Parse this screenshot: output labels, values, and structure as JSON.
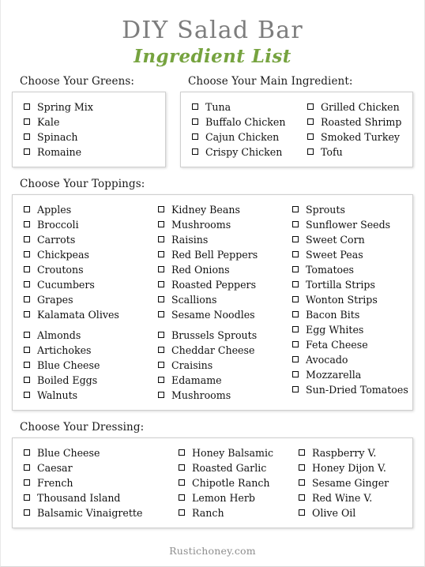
{
  "title": {
    "main": "DIY Salad Bar",
    "sub": "Ingredient List",
    "main_color": "#7d7d7d",
    "sub_color": "#76a33f"
  },
  "sections": {
    "greens": {
      "label": "Choose Your Greens:",
      "items": [
        "Spring Mix",
        "Kale",
        "Spinach",
        "Romaine"
      ]
    },
    "main_ingredient": {
      "label": "Choose Your Main Ingredient:",
      "col1": [
        "Tuna",
        "Buffalo Chicken",
        "Cajun Chicken",
        "Crispy Chicken"
      ],
      "col2": [
        "Grilled Chicken",
        "Roasted Shrimp",
        "Smoked Turkey",
        "Tofu"
      ]
    },
    "toppings": {
      "label": "Choose Your Toppings:",
      "col1": [
        "Apples",
        "Broccoli",
        "Carrots",
        "Chickpeas",
        "Croutons",
        "Cucumbers",
        "Grapes",
        "Kalamata Olives",
        "Almonds",
        "Artichokes",
        "Blue Cheese",
        "Boiled Eggs",
        "Walnuts"
      ],
      "col2": [
        "Kidney Beans",
        "Mushrooms",
        "Raisins",
        "Red Bell Peppers",
        "Red Onions",
        "Roasted Peppers",
        "Scallions",
        "Sesame Noodles",
        "Brussels Sprouts",
        "Cheddar Cheese",
        "Craisins",
        "Edamame",
        "Mushrooms"
      ],
      "col3": [
        "Sprouts",
        "Sunflower Seeds",
        "Sweet Corn",
        "Sweet Peas",
        "Tomatoes",
        "Tortilla Strips",
        "Wonton Strips",
        "Bacon Bits",
        "Egg Whites",
        "Feta Cheese",
        "Avocado",
        "Mozzarella",
        "Sun-Dried Tomatoes"
      ]
    },
    "dressing": {
      "label": "Choose Your Dressing:",
      "col1": [
        "Blue Cheese",
        "Caesar",
        "French",
        "Thousand Island",
        "Balsamic Vinaigrette"
      ],
      "col2": [
        "Honey Balsamic",
        "Roasted Garlic",
        "Chipotle Ranch",
        "Lemon Herb",
        "Ranch"
      ],
      "col3": [
        "Raspberry V.",
        "Honey Dijon V.",
        "Sesame Ginger",
        "Red Wine V.",
        "Olive Oil"
      ]
    }
  },
  "footer": {
    "text": "Rustichoney.com"
  }
}
